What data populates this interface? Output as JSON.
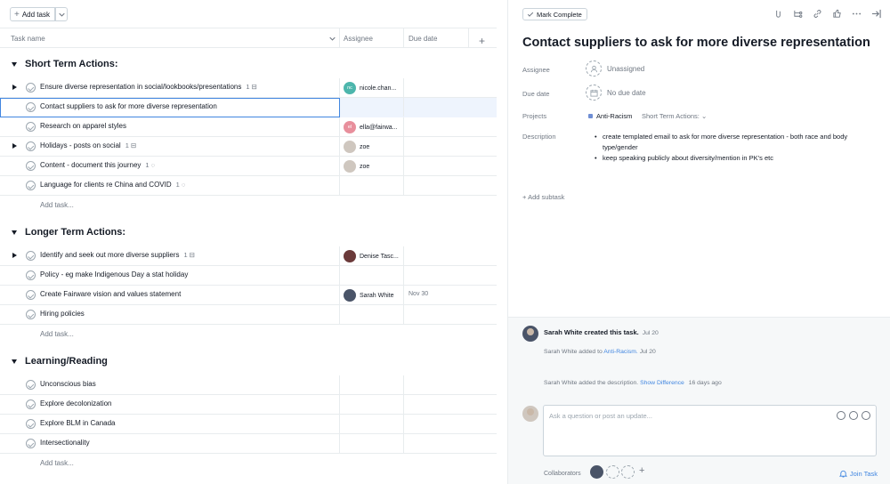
{
  "toolbar": {
    "add_task_label": "Add task"
  },
  "columns": {
    "task_name": "Task name",
    "assignee": "Assignee",
    "due_date": "Due date"
  },
  "sections": [
    {
      "title": "Short Term Actions:"
    },
    {
      "title": "Longer Term Actions:"
    },
    {
      "title": "Learning/Reading"
    }
  ],
  "tasks": [
    {
      "name": "Ensure diverse representation in social/lookbooks/presentations",
      "subcount": "1",
      "assignee": "nicole.chan...",
      "avatar_text": "nc",
      "avatar_color": "#4db6ac"
    },
    {
      "name": "Contact suppliers to ask for more diverse representation"
    },
    {
      "name": "Research on apparel styles",
      "assignee": "ella@fairwa...",
      "avatar_text": "el",
      "avatar_color": "#e88f9c"
    },
    {
      "name": "Holidays - posts on social",
      "subcount": "1",
      "assignee": "zoe",
      "avatar_color": "#cfc7bf"
    },
    {
      "name": "Content - document this journey",
      "comments": "1",
      "assignee": "zoe",
      "avatar_color": "#cfc7bf"
    },
    {
      "name": "Language for clients re China and COVID",
      "comments": "1"
    },
    {
      "name": "Identify and seek out more diverse suppliers",
      "subcount": "1",
      "assignee": "Denise Tasc...",
      "avatar_color": "#6b3a3a"
    },
    {
      "name": "Policy - eg make Indigenous Day a stat holiday"
    },
    {
      "name": "Create Fairware vision and values statement",
      "assignee": "Sarah White",
      "avatar_color": "#4a5468",
      "due": "Nov 30"
    },
    {
      "name": "Hiring policies"
    },
    {
      "name": "Unconscious bias"
    },
    {
      "name": "Explore decolonization"
    },
    {
      "name": "Explore BLM in Canada"
    },
    {
      "name": "Intersectionality"
    }
  ],
  "add_task_row": "Add task...",
  "detail": {
    "mark_complete": "Mark Complete",
    "title": "Contact suppliers to ask for more diverse representation",
    "assignee_label": "Assignee",
    "assignee_value": "Unassigned",
    "due_label": "Due date",
    "due_value": "No due date",
    "projects_label": "Projects",
    "project_name": "Anti-Racism",
    "project_section": "Short Term Actions:",
    "description_label": "Description",
    "description": [
      "create templated email to ask for more diverse representation - both race and body type/gender",
      "keep speaking publicly about diversity/mention in PK's etc"
    ],
    "add_subtask": "Add subtask"
  },
  "activity": {
    "created_text": "Sarah White created this task.",
    "created_date": "Jul 20",
    "added_prefix": "Sarah White added to",
    "added_project": "Anti-Racism.",
    "added_date": "Jul 20",
    "desc_prefix": "Sarah White added the description.",
    "show_difference": "Show Difference",
    "desc_date": "16 days ago",
    "comment_placeholder": "Ask a question or post an update...",
    "collaborators_label": "Collaborators",
    "join_task": "Join Task"
  }
}
